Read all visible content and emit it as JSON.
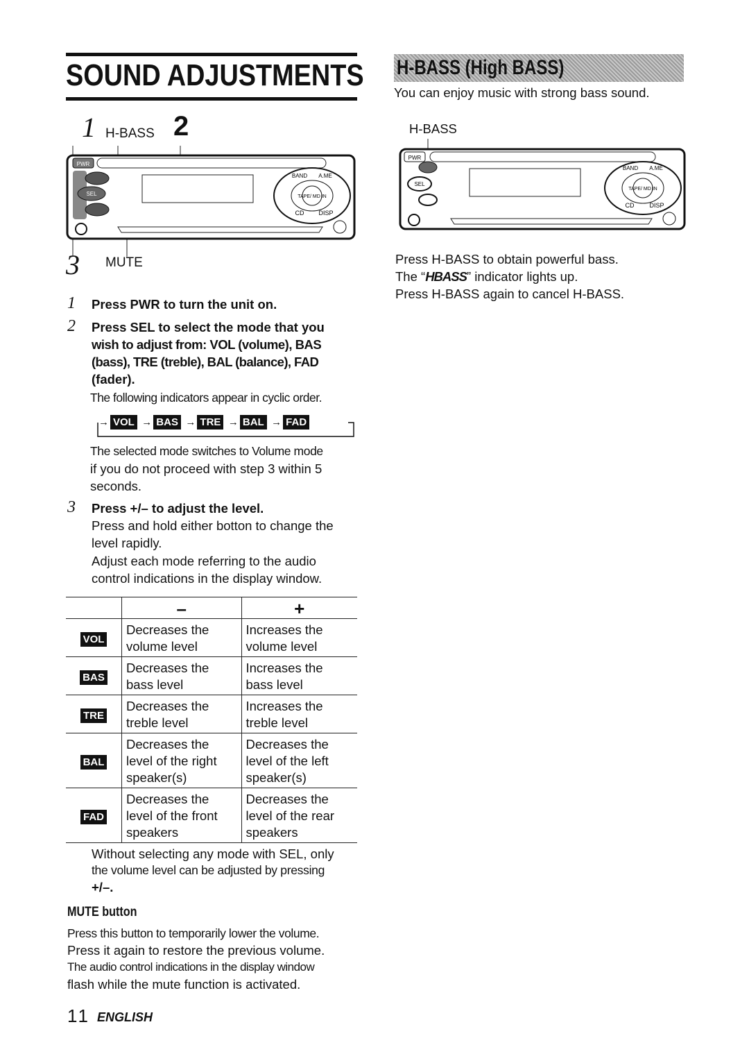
{
  "left": {
    "title": "SOUND ADJUSTMENTS",
    "diagram": {
      "n1": "1",
      "hbass": "H-BASS",
      "n2": "2",
      "n3": "3",
      "mute": "MUTE"
    },
    "device": {
      "pwr": "PWR",
      "sel": "SEL",
      "mute": "MUTE",
      "band": "BAND",
      "ame": "A.ME",
      "tape": "TAPE/ MD IN",
      "cd": "CD",
      "disp": "DISP"
    },
    "step1": {
      "num": "1",
      "text": "Press PWR to turn the unit on."
    },
    "step2": {
      "num": "2",
      "lines": [
        "Press SEL to select the mode that you",
        "wish to adjust from: VOL (volume), BAS",
        "(bass), TRE (treble), BAL (balance), FAD",
        "(fader)."
      ],
      "note": "The following indicators appear in cyclic order.",
      "cycle": [
        "VOL",
        "BAS",
        "TRE",
        "BAL",
        "FAD"
      ],
      "after": [
        "The selected mode switches to Volume mode",
        "if you do not proceed with step 3 within 5",
        "seconds."
      ]
    },
    "step3": {
      "num": "3",
      "text": "Press +/– to adjust the level.",
      "lines": [
        "Press and hold either botton to change the",
        "level rapidly.",
        "Adjust each mode referring to the audio",
        "control indications in the display window."
      ]
    },
    "table": {
      "headers": [
        "–",
        "+"
      ],
      "rows": [
        {
          "mode": "VOL",
          "minus": [
            "Decreases the",
            "volume level"
          ],
          "plus": [
            "Increases the",
            "volume level"
          ]
        },
        {
          "mode": "BAS",
          "minus": [
            "Decreases the",
            "bass level"
          ],
          "plus": [
            "Increases the",
            "bass level"
          ]
        },
        {
          "mode": "TRE",
          "minus": [
            "Decreases the",
            "treble level"
          ],
          "plus": [
            "Increases the",
            "treble level"
          ]
        },
        {
          "mode": "BAL",
          "minus": [
            "Decreases the",
            "level of the right",
            "speaker(s)"
          ],
          "plus": [
            "Decreases the",
            "level of the left",
            "speaker(s)"
          ]
        },
        {
          "mode": "FAD",
          "minus": [
            "Decreases the",
            "level of the front",
            "speakers"
          ],
          "plus": [
            "Decreases the",
            "level of the rear",
            "speakers"
          ]
        }
      ]
    },
    "after_table": [
      "Without selecting any mode with SEL, only",
      "the volume level can be adjusted by pressing",
      "+/–."
    ],
    "mute_heading": "MUTE button",
    "mute_lines": [
      "Press this button to temporarily lower the volume.",
      "Press it again to restore the previous volume.",
      "The audio control indications in the display window",
      "flash while the mute function is activated."
    ],
    "page_number": "11",
    "language": "ENGLISH"
  },
  "right": {
    "heading": "H-BASS (High BASS)",
    "intro": "You can enjoy music with strong bass sound.",
    "label": "H-BASS",
    "lines": [
      "Press H-BASS to obtain powerful bass.",
      "indicator lights up.",
      "Press H-BASS again to cancel H-BASS."
    ],
    "line2_prefix": "The “",
    "indicator": "HBASS",
    "line2_suffix": "” indicator lights up."
  }
}
